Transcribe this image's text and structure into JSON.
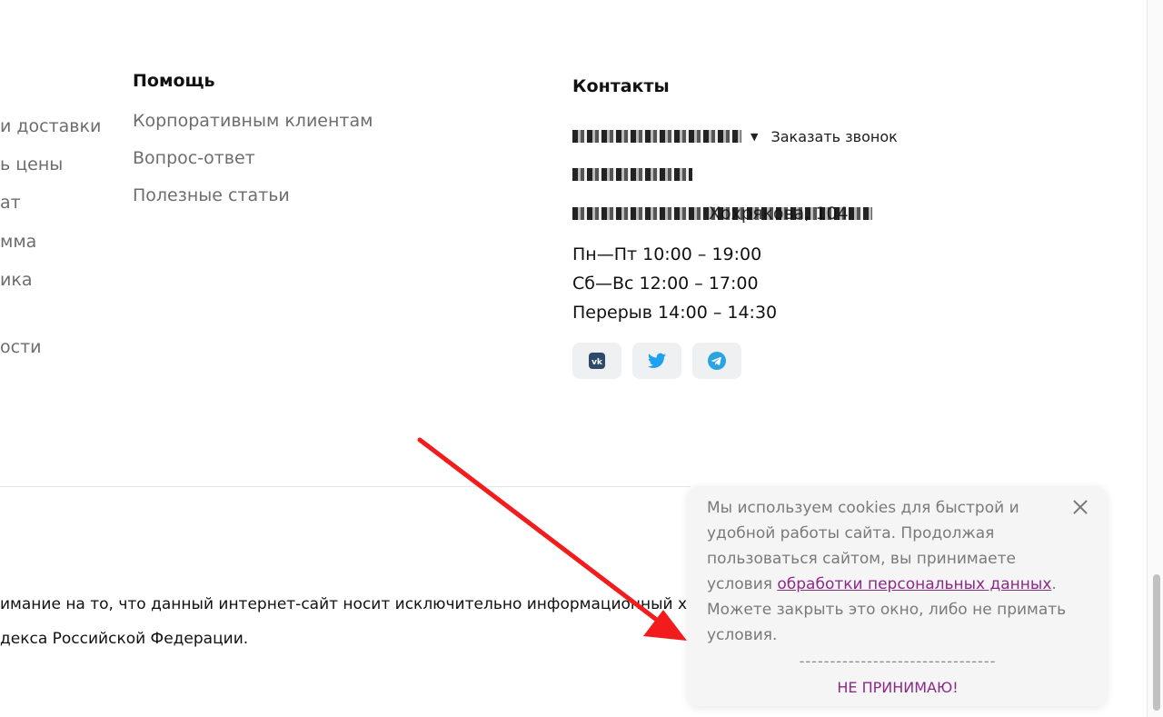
{
  "left_column": {
    "items": [
      "и доставки",
      "ь цены",
      "ат",
      "мма",
      "ика",
      "ости"
    ]
  },
  "help": {
    "title": "Помощь",
    "links": [
      "Корпоративным клиентам",
      "Вопрос-ответ",
      "Полезные статьи"
    ]
  },
  "contacts": {
    "title": "Контакты",
    "call_link": "Заказать звонок",
    "address_visible": "Хохрякова, 104",
    "hours": [
      "Пн—Пт 10:00 – 19:00",
      "Сб—Вс 12:00 – 17:00",
      "Перерыв 14:00 – 14:30"
    ],
    "socials": [
      "vk-icon",
      "twitter-icon",
      "telegram-icon"
    ]
  },
  "footer": {
    "disclaimer_lines": [
      "имание на то, что данный интернет-сайт носит исключительно информационный характер",
      "декса Российской Федерации."
    ]
  },
  "cookie": {
    "text_before": "Мы используем cookies для быстрой и удобной работы сайта. Продолжая пользоваться сайтом, вы принимаете условия ",
    "link_text": "обработки персональных данных",
    "text_after": ". Можете закрыть это окно, либо не примать условия.",
    "separator": "--------------------------------",
    "decline_label": "НЕ ПРИНИМАЮ!"
  },
  "colors": {
    "accent": "#8b2a86",
    "arrow": "#f21c1c",
    "vk": "#2d4a6b",
    "twitter": "#1da1f2",
    "telegram": "#2aa3e0"
  }
}
